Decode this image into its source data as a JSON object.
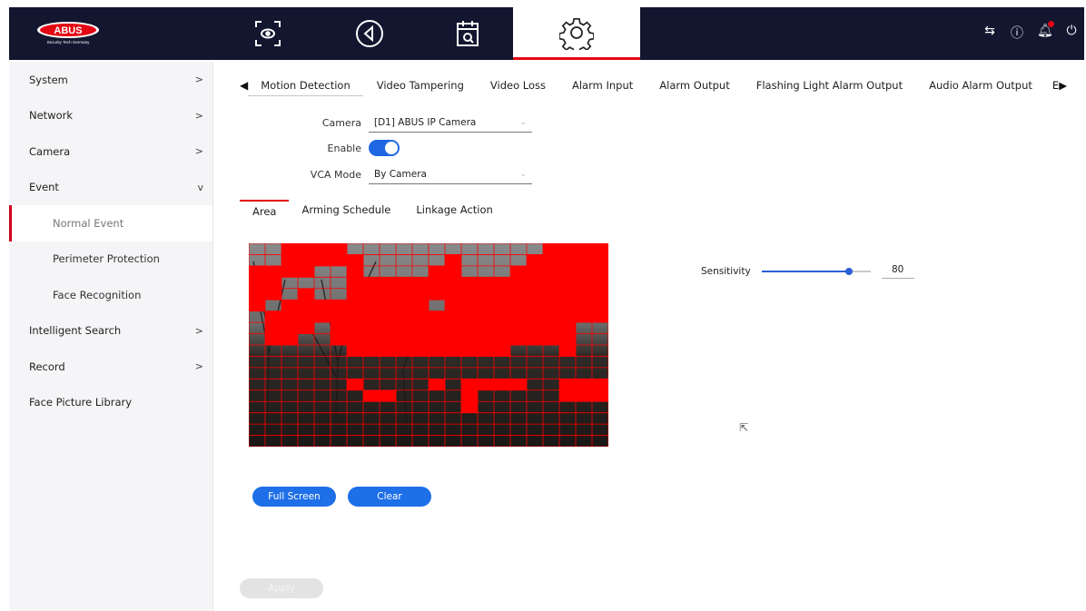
{
  "brand": {
    "logo_text": "ABUS",
    "tagline": "Security Tech Germany",
    "accent": "#e30613"
  },
  "topnav": {
    "icons": [
      "live-view-icon",
      "playback-icon",
      "calendar-icon",
      "settings-icon"
    ],
    "active": "settings-icon",
    "right_icons": [
      "transfer-icon",
      "info-icon",
      "bell-icon",
      "power-icon"
    ]
  },
  "sidebar": {
    "items": [
      {
        "label": "System",
        "chevron": ">"
      },
      {
        "label": "Network",
        "chevron": ">"
      },
      {
        "label": "Camera",
        "chevron": ">"
      },
      {
        "label": "Event",
        "chevron": "v"
      },
      {
        "label": "Normal Event",
        "chevron": ""
      },
      {
        "label": "Perimeter Protection",
        "chevron": ""
      },
      {
        "label": "Face Recognition",
        "chevron": ""
      },
      {
        "label": "Intelligent Search",
        "chevron": ">"
      },
      {
        "label": "Record",
        "chevron": ">"
      },
      {
        "label": "Face Picture Library",
        "chevron": ""
      }
    ]
  },
  "tabs": {
    "items": [
      "Motion Detection",
      "Video Tampering",
      "Video Loss",
      "Alarm Input",
      "Alarm Output",
      "Flashing Light Alarm Output",
      "Audio Alarm Output"
    ],
    "more": "E",
    "active": "Motion Detection"
  },
  "form": {
    "camera_label": "Camera",
    "camera_value": "[D1] ABUS IP Camera",
    "enable_label": "Enable",
    "enable_value": true,
    "vca_label": "VCA Mode",
    "vca_value": "By Camera"
  },
  "subtabs": {
    "items": [
      "Area",
      "Arming Schedule",
      "Linkage Action"
    ],
    "active": "Area"
  },
  "sensitivity": {
    "label": "Sensitivity",
    "value": "80",
    "fraction": 0.8
  },
  "buttons": {
    "full_screen": "Full Screen",
    "clear": "Clear",
    "apply": "Apply"
  },
  "grid": {
    "cols": 22,
    "rows": 18,
    "color": "#ff0000"
  }
}
